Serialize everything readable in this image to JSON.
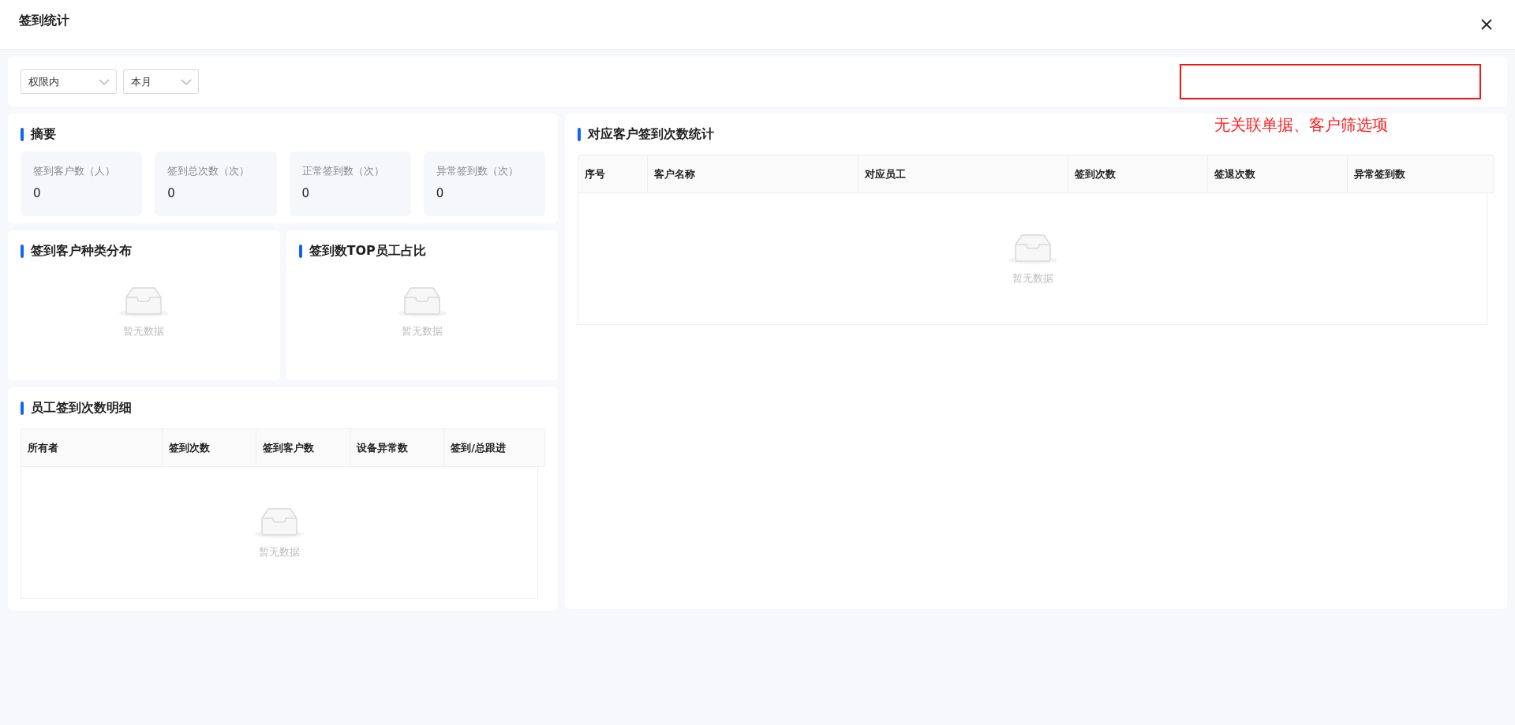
{
  "window": {
    "title": "签到统计"
  },
  "filters": [
    {
      "value": "权限内"
    },
    {
      "value": "本月"
    }
  ],
  "annotation": {
    "text": "无关联单据、客户筛选项"
  },
  "summary": {
    "title": "摘要",
    "stats": [
      {
        "label": "签到客户数（人）",
        "value": "0"
      },
      {
        "label": "签到总次数（次）",
        "value": "0"
      },
      {
        "label": "正常签到数（次）",
        "value": "0"
      },
      {
        "label": "异常签到数（次）",
        "value": "0"
      }
    ]
  },
  "charts": [
    {
      "title": "签到客户种类分布",
      "empty_text": "暂无数据"
    },
    {
      "title": "签到数TOP员工占比",
      "empty_text": "暂无数据"
    }
  ],
  "employee_table": {
    "title": "员工签到次数明细",
    "columns": [
      "所有者",
      "签到次数",
      "签到客户数",
      "设备异常数",
      "签到/总跟进"
    ],
    "empty_text": "暂无数据"
  },
  "customer_table": {
    "title": "对应客户签到次数统计",
    "columns": [
      "序号",
      "客户名称",
      "对应员工",
      "签到次数",
      "签退次数",
      "异常签到数"
    ],
    "empty_text": "暂无数据"
  }
}
